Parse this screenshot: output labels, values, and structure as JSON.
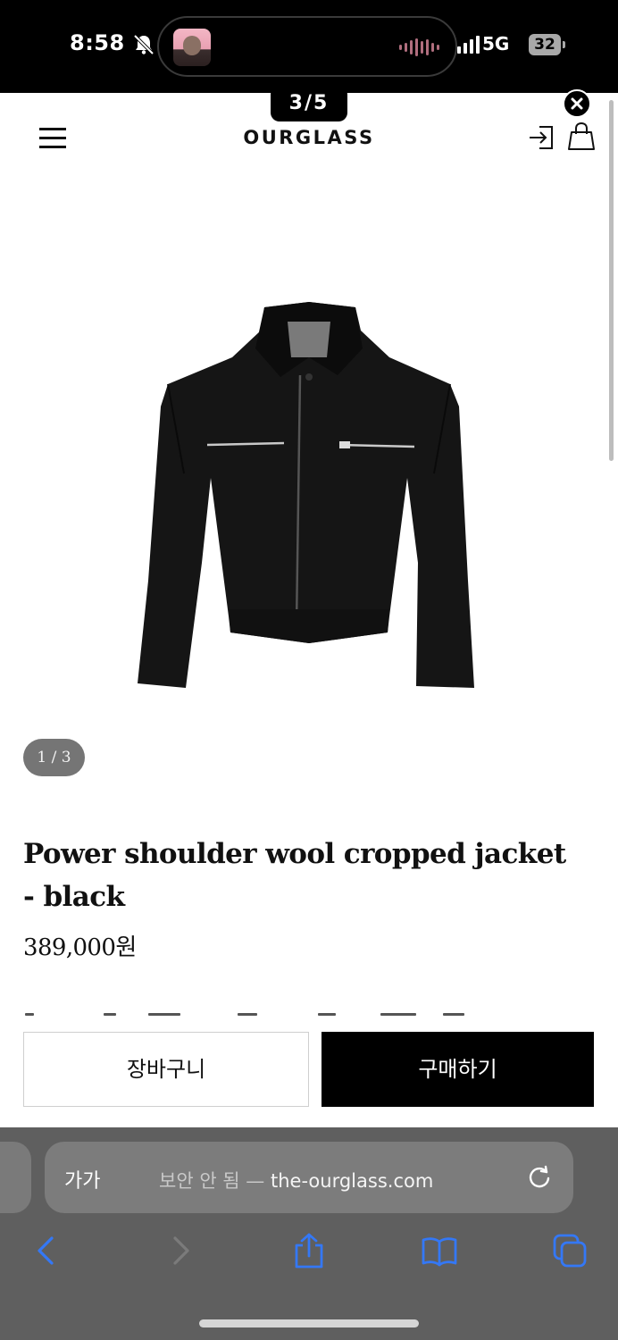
{
  "status_bar": {
    "time": "8:58",
    "network": "5G",
    "battery": "32"
  },
  "overlay": {
    "page_counter": "3/5"
  },
  "header": {
    "brand": "OURGLASS"
  },
  "product": {
    "image_counter": "1 / 3",
    "title": "Power shoulder wool cropped jacket - black",
    "price": "389,000원"
  },
  "actions": {
    "cart_label": "장바구니",
    "buy_label": "구매하기"
  },
  "browser": {
    "text_size_label": "가가",
    "security_label": "보안 안 됨 —",
    "domain": "the-ourglass.com"
  },
  "icons": {
    "menu": "hamburger-icon",
    "login": "login-icon",
    "bag": "shopping-bag-icon",
    "close": "close-icon",
    "reload": "reload-icon",
    "back": "chevron-left-icon",
    "forward": "chevron-right-icon",
    "share": "share-icon",
    "bookmarks": "book-icon",
    "tabs": "tabs-icon"
  },
  "colors": {
    "accent": "#3478f6",
    "buy_button": "#000000"
  }
}
